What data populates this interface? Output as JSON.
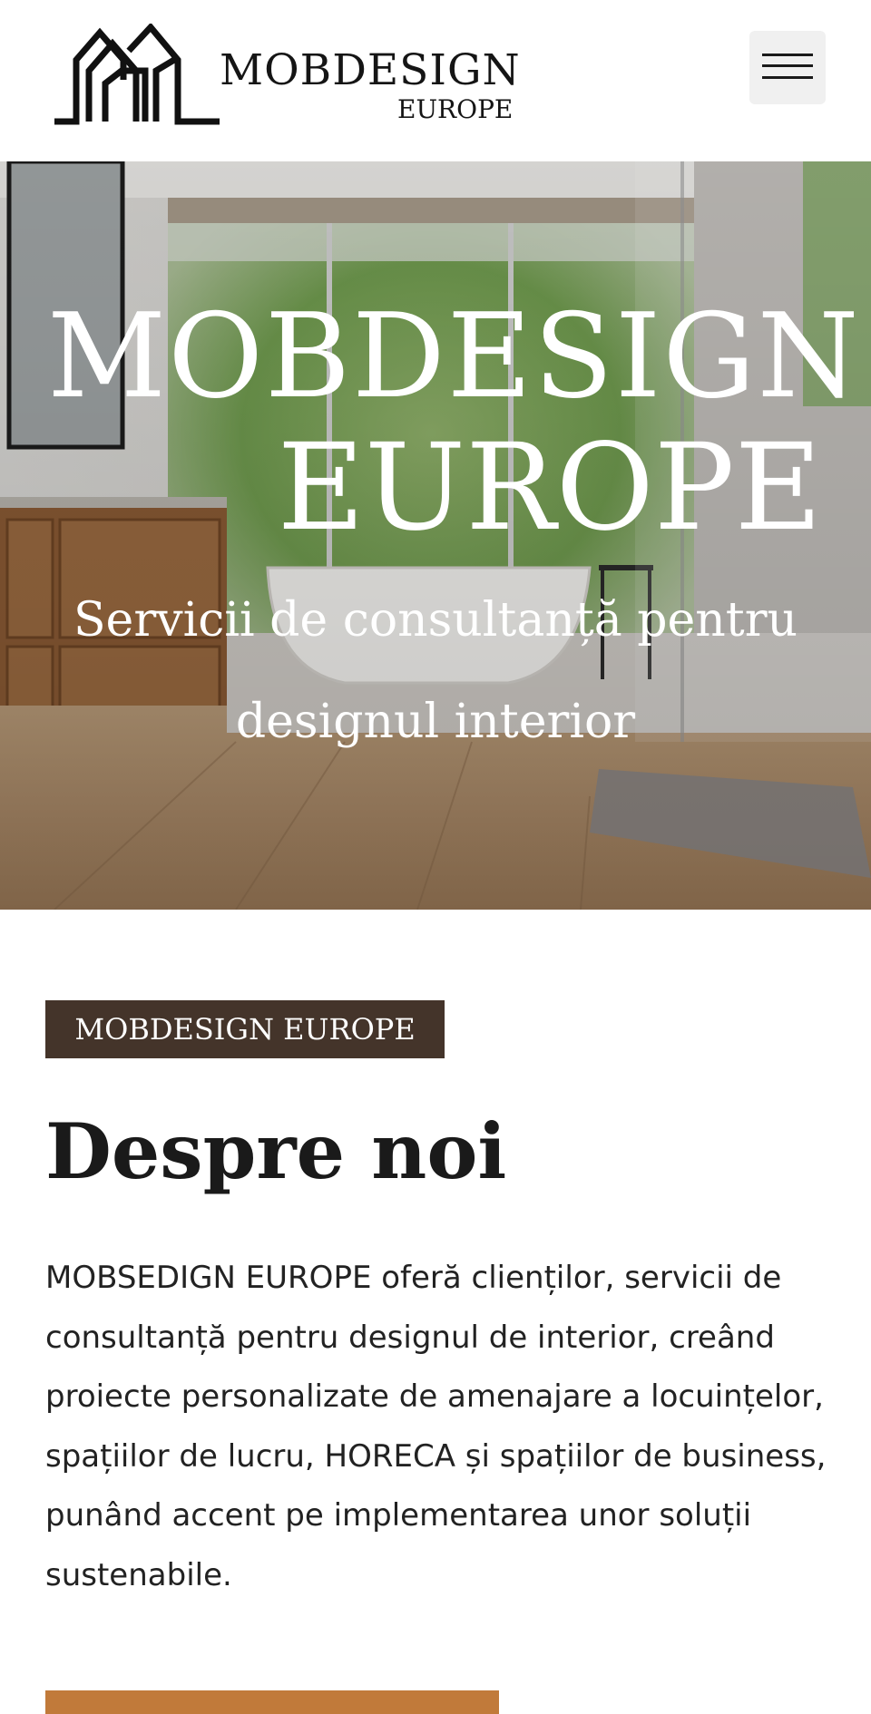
{
  "header": {
    "logo_line1": "MOBDESIGN",
    "logo_line2": "EUROPE"
  },
  "hero": {
    "title_line1": "MOBDESIGN",
    "title_line2": "EUROPE",
    "subtitle": "Servicii de consultanță pentru designul interior"
  },
  "about": {
    "badge": "MOBDESIGN EUROPE",
    "heading": "Despre noi",
    "paragraph": "MOBSEDIGN EUROPE oferă clienților, servicii de consultanță pentru designul de interior, creând proiecte personalizate de amenajare a locuințelor, spațiilor de lucru, HORECA și spațiilor de business, punând accent pe implementarea unor soluții sustenabile."
  },
  "colors": {
    "badge_bg": "#44342a",
    "cta_bg": "#c17a3a",
    "menu_bg": "#f0f0f0"
  },
  "icons": {
    "logo_mark": "house-outline-logo",
    "menu": "hamburger-menu-icon"
  }
}
